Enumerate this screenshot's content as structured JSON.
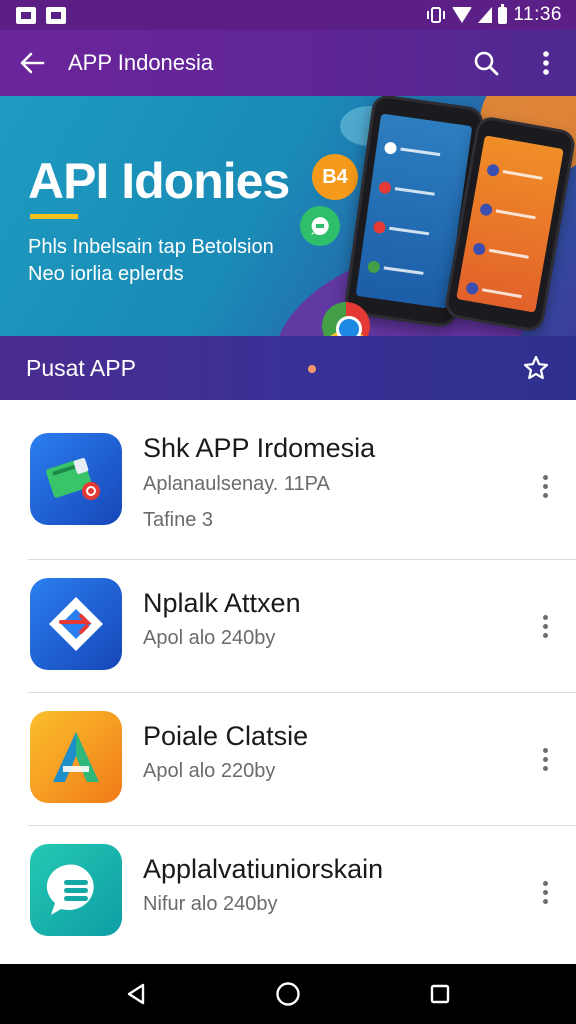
{
  "status_bar": {
    "time": "11:36",
    "icons": [
      "gallery-icon",
      "photo-icon",
      "vibrate-icon",
      "wifi-icon",
      "signal-icon",
      "battery-icon"
    ]
  },
  "app_bar": {
    "title": "APP Indonesia",
    "icons": [
      "back-arrow-icon",
      "search-icon",
      "more-vert-icon"
    ]
  },
  "banner": {
    "title": "API Idonies",
    "subtitle_line1": "Phls Inbelsain tap Betolsion",
    "subtitle_line2": "Neo iorlia eplerds",
    "badge_text": "B4"
  },
  "section": {
    "title": "Pusat APP",
    "icon": "star-outline-icon"
  },
  "apps": [
    {
      "name": "Shk  APP Irdomesia",
      "subtitle": "Aplanaulsenay. 11PA",
      "meta": "Tafine   3",
      "icon": "wallet-icon",
      "icon_color": "#2b7ff0"
    },
    {
      "name": "Nplalk Attxen",
      "subtitle": "Apol alo 240by",
      "icon": "diamond-arrow-icon",
      "icon_color": "#2b7ff0"
    },
    {
      "name": "Poiale Clatsie",
      "subtitle": "Apol alo 220by",
      "icon": "letter-a-icon",
      "icon_color": "#fbc02d"
    },
    {
      "name": "Applalvatiuniorskain",
      "subtitle": "Nifur alo 240by",
      "icon": "chat-bubble-icon",
      "icon_color": "#25c8b3"
    }
  ],
  "nav_bar": {
    "icons": [
      "back-triangle-icon",
      "home-circle-icon",
      "recents-square-icon"
    ]
  },
  "colors": {
    "primary": "#5e2596",
    "status_bar": "#5b1f86",
    "banner_start": "#1d9bc0",
    "accent": "#f7c21b"
  }
}
